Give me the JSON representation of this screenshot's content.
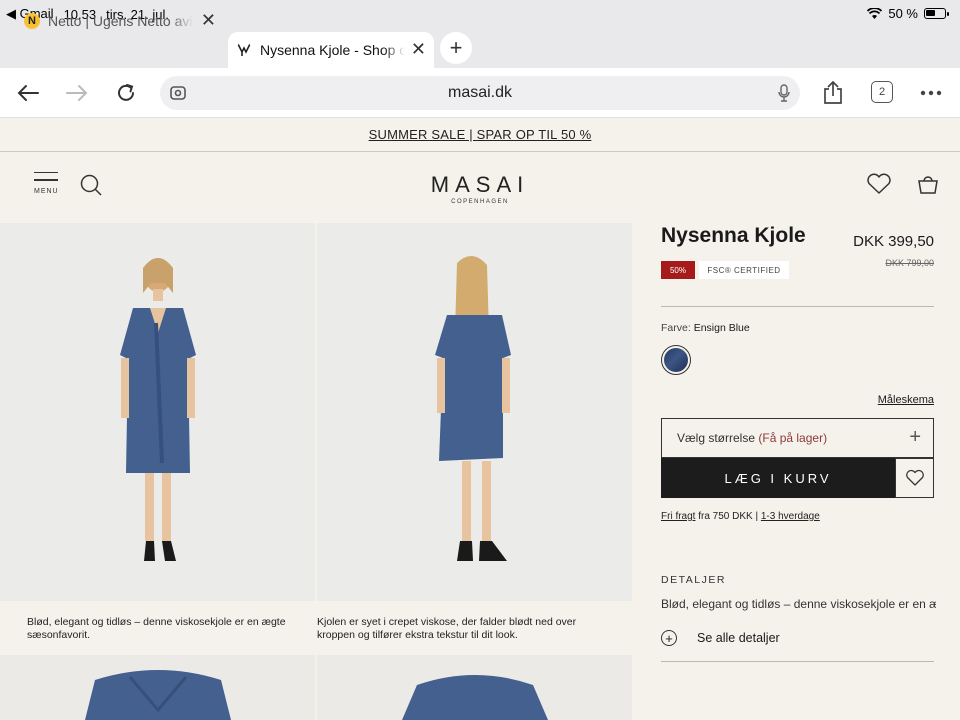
{
  "status_bar": {
    "back_app": "Gmail",
    "time": "10.53",
    "date": "tirs. 21. jul.",
    "battery": "50 %"
  },
  "tabs": [
    {
      "title": "Netto | Ugens Netto avis",
      "favicon": "N"
    },
    {
      "title": "Nysenna Kjole - Shop online",
      "favicon": "M"
    }
  ],
  "toolbar": {
    "url": "masai.dk",
    "tab_count": "2"
  },
  "promo": {
    "text": "SUMMER SALE | SPAR OP TIL 50 %"
  },
  "header": {
    "menu_label": "MENU",
    "logo": "MASAI",
    "logo_sub": "COPENHAGEN"
  },
  "gallery": {
    "captions": [
      "Blød, elegant og tidløs – denne viskosekjole er en ægte sæsonfavorit.",
      "Kjolen er syet i crepet viskose, der falder blødt ned over kroppen og tilfører ekstra tekstur til dit look."
    ]
  },
  "product": {
    "title": "Nysenna Kjole",
    "price": "DKK 399,50",
    "old_price": "DKK 799,00",
    "discount_badge": "50%",
    "cert_badge": "FSC® CERTIFIED",
    "color_label": "Farve:",
    "color_name": "Ensign Blue",
    "size_guide": "Måleskema",
    "size_select": "Vælg størrelse",
    "size_stock": "(Få på lager)",
    "add_to_cart": "LÆG I KURV",
    "shipping_free": "Fri fragt",
    "shipping_mid": "fra 750 DKK |",
    "shipping_days": "1-3 hverdage",
    "details_heading": "DETALJER",
    "details_text": "Blød, elegant og tidløs – denne viskosekjole er en ægte sæsonfavorit.",
    "see_all": "Se alle detaljer"
  },
  "colors": {
    "dress": "#43608f",
    "accent_sale": "#a51b1b",
    "page_bg": "#f5f2ec"
  }
}
